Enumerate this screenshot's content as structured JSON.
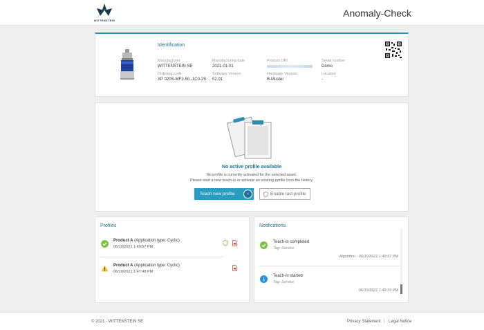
{
  "header": {
    "brand": "WITTENSTEIN",
    "app_title": "Anomaly-Check"
  },
  "identification": {
    "title": "Identification",
    "fields": {
      "manufacturer": {
        "label": "Manufacturer",
        "value": "WITTENSTEIN SE"
      },
      "manufacturing_date": {
        "label": "Manufacturing date",
        "value": "2021-01-01"
      },
      "product_uri": {
        "label": "Product URI"
      },
      "serial_number": {
        "label": "Serial number",
        "value": "Demo"
      },
      "ordering_code": {
        "label": "Ordering code",
        "value": "XP 020S-MF2-50 -1C0-2S"
      },
      "software_version": {
        "label": "Software Version",
        "value": "02.01"
      },
      "hardware_version": {
        "label": "Hardware Version",
        "value": "B-Muster"
      },
      "location": {
        "label": "Location",
        "value": "-"
      }
    }
  },
  "empty_state": {
    "title": "No active profile available",
    "line1": "No profile is currently activated for the selected asset.",
    "line2": "Please start a new teach-in or activate an existing profile from the history.",
    "teach_button": "Teach new profile",
    "enable_button": "Enable last profile"
  },
  "profiles": {
    "title": "Profiles",
    "items": [
      {
        "name": "Product A",
        "type": "(Application type: Cyclic)",
        "date": "06/10/2021 1:49:57 PM",
        "status": "active"
      },
      {
        "name": "Product A",
        "type": "(Application type: Cyclic)",
        "date": "06/10/2021 1:47:48 PM",
        "status": "warning"
      }
    ]
  },
  "notifications": {
    "title": "Notifications",
    "items": [
      {
        "title": "Teach-in completed",
        "tag": "Tag: Service",
        "meta": "Algorithm - 06/10/2021 1:49:57 PM",
        "kind": "success"
      },
      {
        "title": "Teach-in started",
        "tag": "Tag: Service",
        "meta": "06/10/2021 1:49:33 PM",
        "kind": "info"
      }
    ]
  },
  "footer": {
    "copyright": "© 2021 - WITTENSTEIN SE",
    "privacy": "Privacy Statement",
    "separator": "|",
    "legal": "Legal Notice"
  },
  "colors": {
    "accent": "#2a9dc2",
    "title_blue": "#1f6f97",
    "success": "#7cc243",
    "warning": "#f2c21b",
    "info": "#2b8fe0"
  }
}
